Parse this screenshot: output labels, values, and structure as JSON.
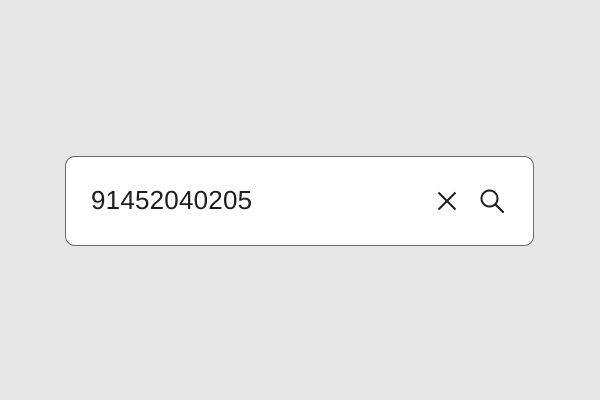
{
  "search": {
    "value": "91452040205"
  },
  "icons": {
    "clear": "close-icon",
    "submit": "search-icon"
  },
  "colors": {
    "background": "#e7e7e7",
    "field": "#ffffff",
    "border": "#6b6b6b",
    "text": "#1e1e1e"
  }
}
